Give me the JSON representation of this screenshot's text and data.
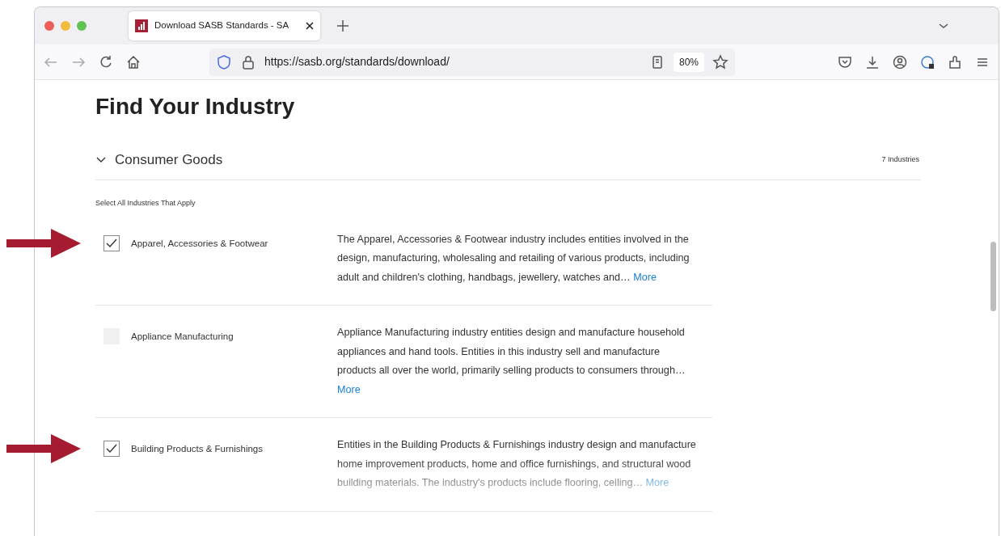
{
  "window": {
    "tab_title": "Download SASB Standards - SA",
    "url": "https://sasb.org/standards/download/",
    "zoom": "80%"
  },
  "page": {
    "title": "Find Your Industry",
    "section": {
      "name": "Consumer Goods",
      "expanded": true,
      "count": "7 Industries"
    },
    "instruction": "Select All Industries That Apply",
    "industries": [
      {
        "name": "Apparel, Accessories & Footwear",
        "checked": true,
        "marked": true,
        "faded": false,
        "description": "The Apparel, Accessories & Footwear industry includes entities involved in the design, manufacturing, wholesaling and retailing of various products, including adult and children's clothing, handbags, jewellery, watches and…",
        "more": "More"
      },
      {
        "name": "Appliance Manufacturing",
        "checked": false,
        "marked": false,
        "faded": false,
        "description": "Appliance Manufacturing industry entities design and manufacture household appliances and hand tools. Entities in this industry sell and manufacture products all over the world, primarily selling products to consumers through…",
        "more": "More"
      },
      {
        "name": "Building Products & Furnishings",
        "checked": true,
        "marked": true,
        "faded": true,
        "description": "Entities in the Building Products & Furnishings industry design and manufacture home improvement products, home and office furnishings, and structural wood building materials. The industry's products include flooring, ceiling…",
        "more": "More"
      }
    ]
  }
}
